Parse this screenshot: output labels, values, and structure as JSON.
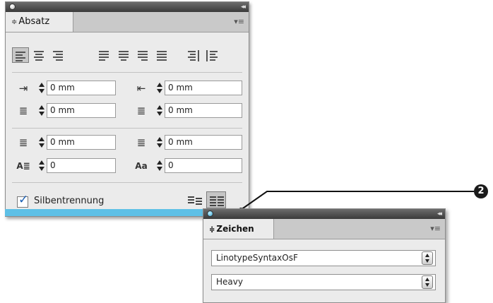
{
  "absatz_panel": {
    "tab_arrows": "≑",
    "tab_label": "Absatz",
    "menu_glyph": "▾≡",
    "collapse_glyph": "◂◂",
    "fields": [
      {
        "value": "0 mm",
        "icon": "left-indent-icon"
      },
      {
        "value": "0 mm",
        "icon": "right-indent-icon"
      },
      {
        "value": "0 mm",
        "icon": "first-line-indent-icon"
      },
      {
        "value": "0 mm",
        "icon": "last-line-indent-icon"
      },
      {
        "value": "0 mm",
        "icon": "space-before-icon"
      },
      {
        "value": "0 mm",
        "icon": "space-after-icon"
      },
      {
        "value": "0",
        "icon": "drop-cap-lines-icon"
      },
      {
        "value": "0",
        "icon": "drop-cap-characters-icon"
      }
    ],
    "hyphenation_label": "Silbentrennung",
    "hyphenation_checked": true
  },
  "zeichen_panel": {
    "tab_arrows": "≑",
    "tab_label": "Zeichen",
    "menu_glyph": "▾≡",
    "collapse_glyph": "◂◂",
    "font_family": "LinotypeSyntaxOsF",
    "font_style": "Heavy"
  },
  "callout": {
    "number": "2"
  },
  "colors": {
    "panel_bg": "#ebebeb",
    "titlebar": "#4a4a4a",
    "accent_bar": "#5ec0e6",
    "checkbox_check": "#1a5fb4"
  }
}
